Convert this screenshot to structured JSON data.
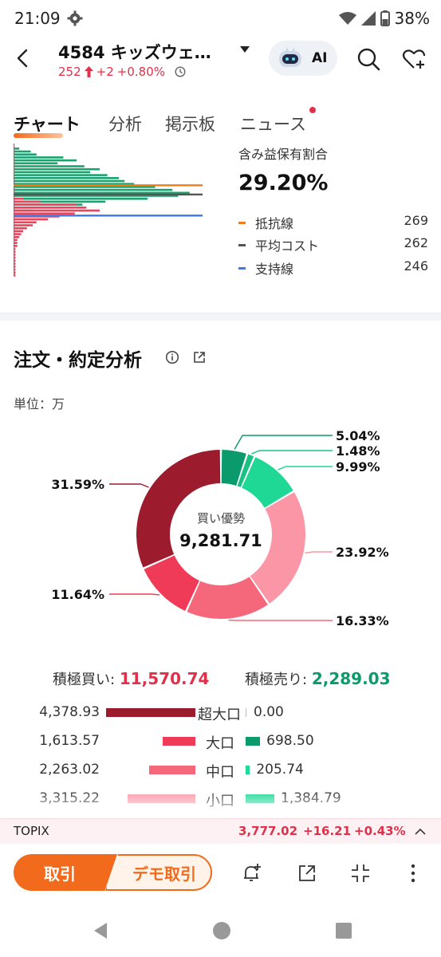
{
  "status": {
    "time": "21:09",
    "battery": "38%"
  },
  "header": {
    "title": "4584  キッズウェ…",
    "price": "252",
    "change": "+2",
    "change_pct": "+0.80%",
    "ai_label": "AI"
  },
  "tabs": [
    {
      "label": "チャート",
      "active": true
    },
    {
      "label": "分析",
      "active": false
    },
    {
      "label": "掲示板",
      "active": false
    },
    {
      "label": "ニュース",
      "active": false,
      "dot": true
    }
  ],
  "holding": {
    "label": "含み益保有割合",
    "value": "29.20%",
    "legend": [
      {
        "name": "抵抗線",
        "value": "269",
        "color": "#f07d1a"
      },
      {
        "name": "平均コスト",
        "value": "262",
        "color": "#555555"
      },
      {
        "name": "支持線",
        "value": "246",
        "color": "#3a7bea"
      }
    ]
  },
  "price_profile": {
    "rows": [
      {
        "green": 0.03,
        "red": 0.0
      },
      {
        "green": 0.09,
        "red": 0.0
      },
      {
        "green": 0.12,
        "red": 0.0
      },
      {
        "green": 0.26,
        "red": 0.0
      },
      {
        "green": 0.33,
        "red": 0.0
      },
      {
        "green": 0.23,
        "red": 0.0
      },
      {
        "green": 0.37,
        "red": 0.0
      },
      {
        "green": 0.45,
        "red": 0.0
      },
      {
        "green": 0.4,
        "red": 0.0
      },
      {
        "green": 0.49,
        "red": 0.0
      },
      {
        "green": 0.55,
        "red": 0.0
      },
      {
        "green": 0.58,
        "red": 0.0
      },
      {
        "green": 0.63,
        "red": 0.0
      },
      {
        "green": 0.74,
        "red": 0.0
      },
      {
        "green": 0.83,
        "red": 0.0
      },
      {
        "green": 0.92,
        "red": 0.0
      },
      {
        "green": 0.86,
        "red": 0.0
      },
      {
        "green": 0.7,
        "red": 0.05
      },
      {
        "green": 0.48,
        "red": 0.14
      },
      {
        "green": 0.36,
        "red": 0.33
      },
      {
        "green": 0.25,
        "red": 0.38
      },
      {
        "green": 0.1,
        "red": 0.45
      },
      {
        "green": 0.0,
        "red": 0.32
      },
      {
        "green": 0.0,
        "red": 0.24
      },
      {
        "green": 0.0,
        "red": 0.18
      },
      {
        "green": 0.0,
        "red": 0.12
      },
      {
        "green": 0.0,
        "red": 0.1
      },
      {
        "green": 0.0,
        "red": 0.07
      },
      {
        "green": 0.0,
        "red": 0.05
      },
      {
        "green": 0.0,
        "red": 0.04
      },
      {
        "green": 0.0,
        "red": 0.03
      },
      {
        "green": 0.0,
        "red": 0.02
      },
      {
        "green": 0.0,
        "red": 0.02
      },
      {
        "green": 0.0,
        "red": 0.02
      },
      {
        "green": 0.0,
        "red": 0.01
      },
      {
        "green": 0.0,
        "red": 0.01
      },
      {
        "green": 0.0,
        "red": 0.01
      },
      {
        "green": 0.0,
        "red": 0.01
      },
      {
        "green": 0.0,
        "red": 0.01
      },
      {
        "green": 0.0,
        "red": 0.01
      },
      {
        "green": 0.0,
        "red": 0.01
      },
      {
        "green": 0.0,
        "red": 0.01
      },
      {
        "green": 0.0,
        "red": 0.01
      },
      {
        "green": 0.0,
        "red": 0.01
      }
    ],
    "lines": [
      {
        "name": "抵抗線",
        "price": 269,
        "color": "#f07d1a"
      },
      {
        "name": "平均コスト",
        "price": 262,
        "color": "#555555"
      },
      {
        "name": "支持線",
        "price": 246,
        "color": "#3a7bea"
      }
    ]
  },
  "section": {
    "title": "注文・約定分析",
    "unit": "単位：万"
  },
  "chart_data": {
    "type": "pie",
    "center_label": "買い優勢",
    "center_value": "9,281.71",
    "slices": [
      {
        "label": "超大口 売り",
        "pct": 5.04,
        "text": "5.04%",
        "color": "#0a9a6b"
      },
      {
        "label": "大口 売り",
        "pct": 1.48,
        "text": "1.48%",
        "color": "#18c283"
      },
      {
        "label": "中口 売り",
        "pct": 9.99,
        "text": "9.99%",
        "color": "#1fd896"
      },
      {
        "label": "小口 買い",
        "pct": 23.92,
        "text": "23.92%",
        "color": "#fb96a6"
      },
      {
        "label": "中口 買い",
        "pct": 16.33,
        "text": "16.33%",
        "color": "#f5687c"
      },
      {
        "label": "大口 買い",
        "pct": 11.64,
        "text": "11.64%",
        "color": "#ef3b57"
      },
      {
        "label": "超大口 買い",
        "pct": 31.59,
        "text": "31.59%",
        "color": "#9c1c2e"
      }
    ]
  },
  "totals": {
    "buy_label": "積極買い:",
    "buy_value": "11,570.74",
    "sell_label": "積極売り:",
    "sell_value": "2,289.03"
  },
  "breakdown": [
    {
      "name": "超大口",
      "buy": "4,378.93",
      "buy_num": 4378.93,
      "buy_color": "#9c1c2e",
      "sell": "0.00",
      "sell_num": 0.0,
      "sell_color": "#0a9a6b"
    },
    {
      "name": "大口",
      "buy": "1,613.57",
      "buy_num": 1613.57,
      "buy_color": "#ef3b57",
      "sell": "698.50",
      "sell_num": 698.5,
      "sell_color": "#0a9a6b"
    },
    {
      "name": "中口",
      "buy": "2,263.02",
      "buy_num": 2263.02,
      "buy_color": "#f5687c",
      "sell": "205.74",
      "sell_num": 205.74,
      "sell_color": "#1fd896"
    },
    {
      "name": "小口",
      "buy": "3,315.22",
      "buy_num": 3315.22,
      "buy_color": "#fb96a6",
      "sell": "1,384.79",
      "sell_num": 1384.79,
      "sell_color": "#1fd896"
    }
  ],
  "topix": {
    "name": "TOPIX",
    "value": "3,777.02",
    "change": "+16.21",
    "change_pct": "+0.43%"
  },
  "actions": {
    "trade_label": "取引",
    "demo_label": "デモ取引"
  },
  "icons": {
    "settings": "gear-icon",
    "wifi": "wifi-icon",
    "signal": "signal-icon",
    "battery": "battery-icon",
    "back": "back-arrow-icon",
    "dropdown": "caret-down-icon",
    "robot": "robot-icon",
    "search": "search-icon",
    "watchlist": "heart-plus-icon",
    "clock": "clock-icon",
    "info": "info-icon",
    "share": "share-icon",
    "alert": "bell-plus-icon",
    "collapse": "collapse-icon",
    "more": "more-vertical-icon",
    "expand": "chevron-up-icon"
  }
}
